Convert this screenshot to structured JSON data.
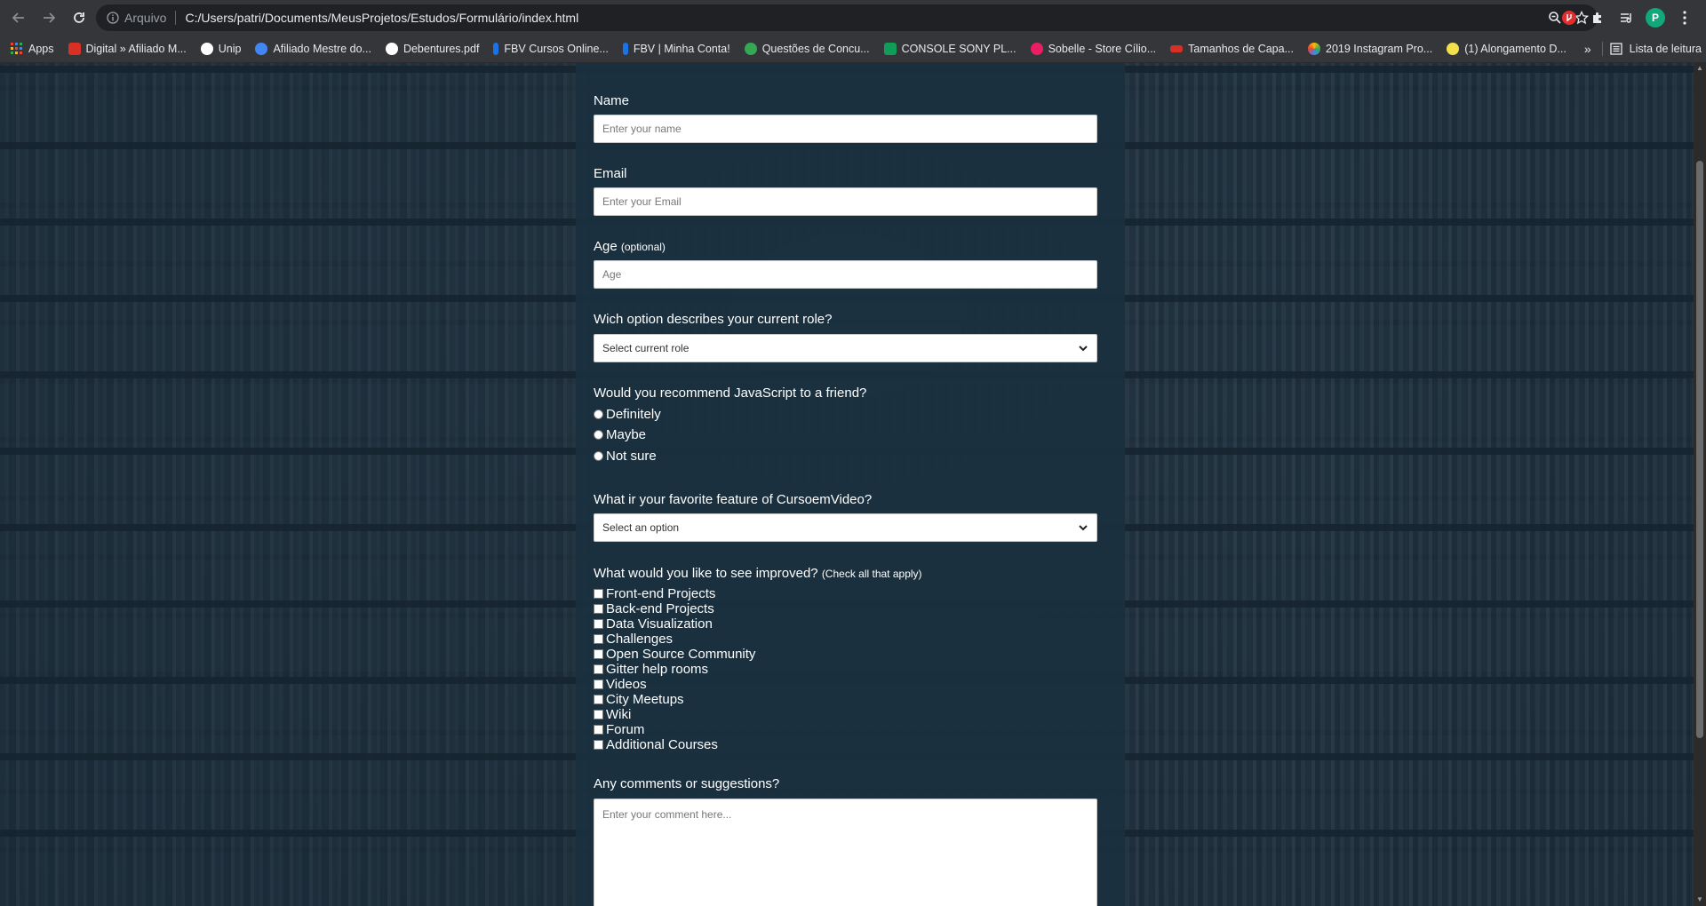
{
  "browser": {
    "secure_label": "Arquivo",
    "url": "C:/Users/patri/Documents/MeusProjetos/Estudos/Formulário/index.html",
    "profile_initial": "P"
  },
  "bookmarks": {
    "items": [
      {
        "label": "Apps",
        "color": "#f4b400"
      },
      {
        "label": "Digital » Afiliado M...",
        "color": "#d93025"
      },
      {
        "label": "Unip",
        "color": "#ffffff"
      },
      {
        "label": "Afiliado Mestre do...",
        "color": "#4285f4"
      },
      {
        "label": "Debentures.pdf",
        "color": "#ffffff"
      },
      {
        "label": "FBV Cursos Online...",
        "color": "#1a73e8"
      },
      {
        "label": "FBV | Minha Conta!",
        "color": "#1a73e8"
      },
      {
        "label": "Questões de Concu...",
        "color": "#34a853"
      },
      {
        "label": "CONSOLE SONY PL...",
        "color": "#0f9d58"
      },
      {
        "label": "Sobelle - Store Cílio...",
        "color": "#e91e63"
      },
      {
        "label": "Tamanhos de Capa...",
        "color": "#d93025"
      },
      {
        "label": "2019 Instagram Pro...",
        "color": "#fbbc04"
      },
      {
        "label": "(1) Alongamento D...",
        "color": "#f4e04d"
      }
    ],
    "more": "»",
    "reading_list": "Lista de leitura"
  },
  "form": {
    "name_label": "Name",
    "name_placeholder": "Enter your name",
    "email_label": "Email",
    "email_placeholder": "Enter your Email",
    "age_label": "Age",
    "age_optional": "(optional)",
    "age_placeholder": "Age",
    "role_label": "Wich option describes your current role?",
    "role_selected": "Select current role",
    "recommend_label": "Would you recommend JavaScript to a friend?",
    "recommend_options": [
      "Definitely",
      "Maybe",
      "Not sure"
    ],
    "feature_label": "What ir your favorite feature of CursoemVideo?",
    "feature_selected": "Select an option",
    "improve_label": "What would you like to see improved?",
    "improve_hint": "(Check all that apply)",
    "improve_options": [
      "Front-end Projects",
      "Back-end Projects",
      "Data Visualization",
      "Challenges",
      "Open Source Community",
      "Gitter help rooms",
      "Videos",
      "City Meetups",
      "Wiki",
      "Forum",
      "Additional Courses"
    ],
    "comments_label": "Any comments or suggestions?",
    "comments_placeholder": "Enter your comment here..."
  }
}
